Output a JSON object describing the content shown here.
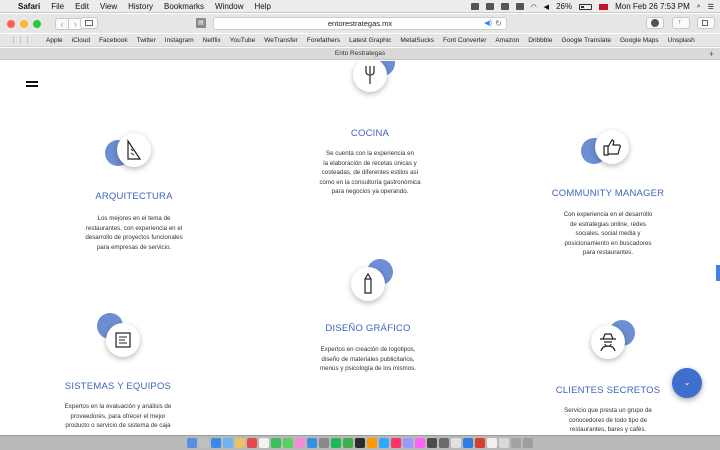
{
  "menubar": {
    "app_name": "Safari",
    "items": [
      "File",
      "Edit",
      "View",
      "History",
      "Bookmarks",
      "Window",
      "Help"
    ],
    "battery": "26%",
    "clock": "Mon Feb 26  7:53 PM"
  },
  "toolbar": {
    "url": "entorestrategas.mx"
  },
  "bookmarks": [
    "Apple",
    "iCloud",
    "Facebook",
    "Twitter",
    "Instagram",
    "Netflix",
    "YouTube",
    "WeTransfer",
    "Forefathers",
    "Latest Graphic",
    "MetalSucks",
    "Font Converter",
    "Amazon",
    "Dribbble",
    "Google Translate",
    "Google Maps",
    "Unsplash"
  ],
  "tab": {
    "title": "Ento Restrategas"
  },
  "services": [
    {
      "icon": "pencil-ruler-icon",
      "title": "ARQUITECTURA",
      "desc": [
        "Los mejores en el tema de",
        "restaurantes, con experiencia en el",
        "desarrollo de proyectos funcionales",
        "para empresas de servicio."
      ]
    },
    {
      "icon": "fork-icon",
      "title": "COCINA",
      "desc": [
        "Se cuenta con la experiencia en",
        "la elaboración de recetas únicas y",
        "costeadas, de diferentes estilos así",
        "como en la consultoría gastronómica",
        "para negocios ya operando."
      ]
    },
    {
      "icon": "thumbs-up-icon",
      "title": "COMMUNITY MANAGER",
      "desc": [
        "Con experiencia en el desarrollo",
        "de estrategias online, redes",
        "sociales, social media y",
        "posicionamiento en buscadores",
        "para restaurantes."
      ]
    },
    {
      "icon": "pencil-icon",
      "title": "DISEÑO GRÁFICO",
      "desc": [
        "Expertos en creación de logotipos,",
        "diseño de materiales publicitarios,",
        "menús y psicología de los mismos."
      ]
    },
    {
      "icon": "monitor-icon",
      "title": "SISTEMAS Y EQUIPOS",
      "desc": [
        "Expertos en la evaluación y análisis de",
        "proveedores, para ofrecer el mejor",
        "producto o servicio de sistema de caja"
      ]
    },
    {
      "icon": "spy-icon",
      "title": "CLIENTES SECRETOS",
      "desc": [
        "Servicio que presta un grupo de",
        "conocedores de todo tipo de",
        "restaurantes, bares y cafés."
      ]
    }
  ],
  "colors": {
    "accent": "#3e64c0",
    "circle": "#6d8ed2",
    "fab": "#3e6fcd"
  }
}
